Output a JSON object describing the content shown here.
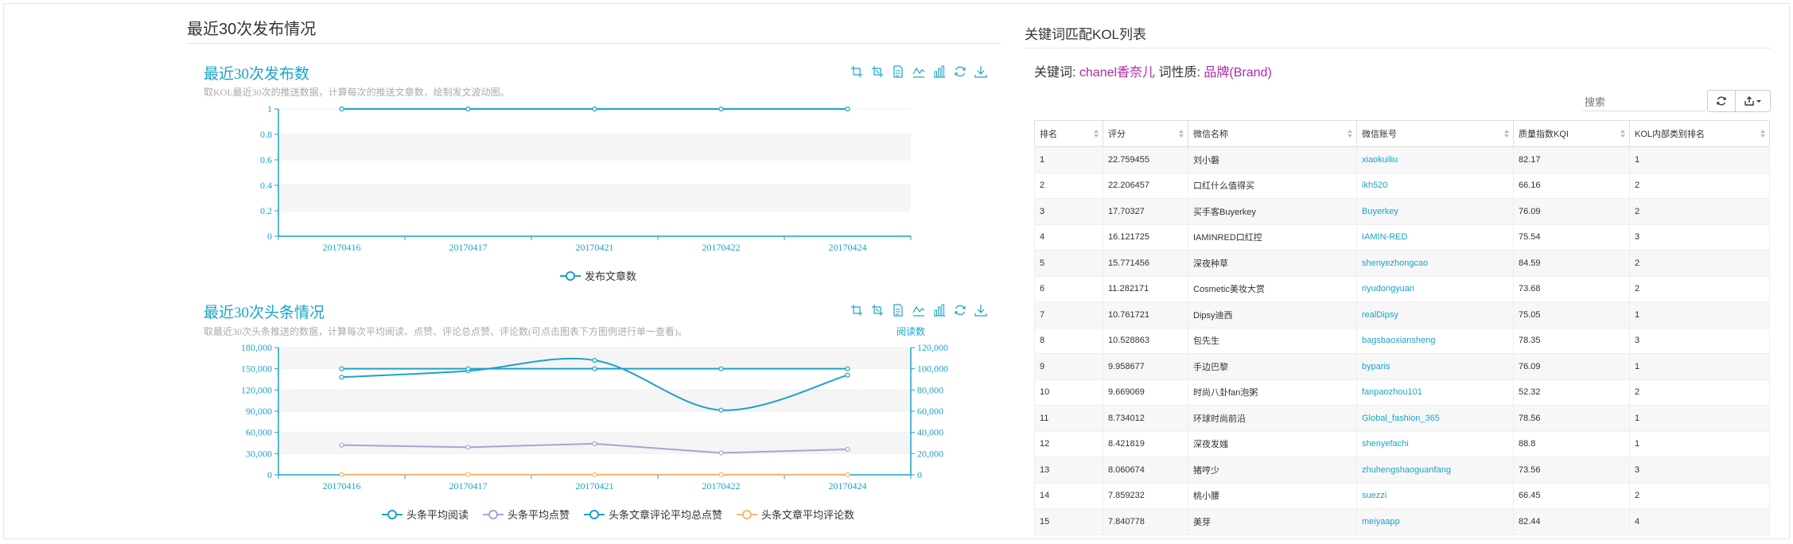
{
  "left": {
    "section_title": "最近30次发布情况",
    "chart1": {
      "title": "最近30次发布数",
      "subtitle": "取KOL最近30次的推送数据，计算每次的推送文章数，绘制发文波动图。"
    },
    "chart2": {
      "title": "最近30次头条情况",
      "subtitle": "取最近30次头条推送的数据，计算每次平均阅读、点赞、评论总点赞、评论数(可点击图表下方图例进行单一查看)。",
      "right_axis_name": "阅读数"
    },
    "toolbox_icons": [
      "zoom-icon",
      "zoom-reset-icon",
      "data-view-icon",
      "line-chart-icon",
      "bar-chart-icon",
      "restore-icon",
      "download-icon"
    ]
  },
  "chart_data": [
    {
      "type": "line",
      "title": "最近30次发布数",
      "categories": [
        "20170416",
        "20170417",
        "20170421",
        "20170422",
        "20170424"
      ],
      "series": [
        {
          "name": "发布文章数",
          "values": [
            1,
            1,
            1,
            1,
            1
          ],
          "color": "#1aa3c9"
        }
      ],
      "ylim": [
        0,
        1
      ],
      "yticks": [
        0,
        0.2,
        0.4,
        0.6,
        0.8,
        1
      ],
      "ytick_labels": [
        "0",
        "0.2",
        "0.4",
        "0.6",
        "0.8",
        "1"
      ],
      "grid": true,
      "legend": "bottom"
    },
    {
      "type": "line",
      "title": "最近30次头条情况",
      "categories": [
        "20170416",
        "20170417",
        "20170421",
        "20170422",
        "20170424"
      ],
      "series": [
        {
          "name": "头条平均阅读",
          "values": [
            92000,
            98000,
            108000,
            61000,
            94000
          ],
          "color": "#1aa3c9",
          "axis": "right"
        },
        {
          "name": "头条平均点赞",
          "values": [
            42000,
            39000,
            44000,
            31000,
            36000
          ],
          "color": "#b39ddb",
          "axis": "left"
        },
        {
          "name": "头条文章评论平均总点赞",
          "values": [
            150000,
            150000,
            150000,
            150000,
            150000
          ],
          "color": "#1aa3c9",
          "axis": "left"
        },
        {
          "name": "头条文章平均评论数",
          "values": [
            300,
            300,
            300,
            300,
            300
          ],
          "color": "#f5b971",
          "axis": "left"
        }
      ],
      "ylim": [
        0,
        180000
      ],
      "yticks": [
        0,
        30000,
        60000,
        90000,
        120000,
        150000,
        180000
      ],
      "ytick_labels": [
        "0",
        "30,000",
        "60,000",
        "90,000",
        "120,000",
        "150,000",
        "180,000"
      ],
      "y2lim": [
        0,
        120000
      ],
      "y2ticks": [
        0,
        20000,
        40000,
        60000,
        80000,
        100000,
        120000
      ],
      "y2tick_labels": [
        "0",
        "20,000",
        "40,000",
        "60,000",
        "80,000",
        "100,000",
        "120,000"
      ],
      "y2label": "阅读数",
      "grid": true,
      "legend": "bottom"
    }
  ],
  "right": {
    "title": "关键词匹配KOL列表",
    "keyword_label": "关键词:",
    "keyword_value": "chanel香奈儿",
    "nature_label": "词性质:",
    "nature_value": "品牌(Brand)",
    "search_placeholder": "搜索",
    "columns": [
      "排名",
      "评分",
      "微信名称",
      "微信账号",
      "质量指数KQI",
      "KOL内部类别排名"
    ],
    "rows": [
      [
        "1",
        "22.759455",
        "刘小磐",
        "xiaokuiliu",
        "82.17",
        "1"
      ],
      [
        "2",
        "22.206457",
        "口红什么值得买",
        "ikh520",
        "66.16",
        "2"
      ],
      [
        "3",
        "17.70327",
        "买手客Buyerkey",
        "Buyerkey",
        "76.09",
        "2"
      ],
      [
        "4",
        "16.121725",
        "IAMINRED口红控",
        "IAMIN-RED",
        "75.54",
        "3"
      ],
      [
        "5",
        "15.771456",
        "深夜种草",
        "shenyezhongcao",
        "84.59",
        "2"
      ],
      [
        "6",
        "11.282171",
        "Cosmetic美妆大赏",
        "riyudongyuan",
        "73.68",
        "2"
      ],
      [
        "7",
        "10.761721",
        "Dipsy迪西",
        "realDipsy",
        "75.05",
        "1"
      ],
      [
        "8",
        "10.528863",
        "包先生",
        "bagsbaoxiansheng",
        "78.35",
        "3"
      ],
      [
        "9",
        "9.958677",
        "手边巴黎",
        "byparis",
        "76.09",
        "1"
      ],
      [
        "10",
        "9.669069",
        "时尚八卦fan泡粥",
        "fanpaozhou101",
        "52.32",
        "2"
      ],
      [
        "11",
        "8.734012",
        "环球时尚前沿",
        "Global_fashion_365",
        "78.56",
        "1"
      ],
      [
        "12",
        "8.421819",
        "深夜发媸",
        "shenyefachi",
        "88.8",
        "1"
      ],
      [
        "13",
        "8.060674",
        "猪哼少",
        "zhuhengshaoguanfang",
        "73.56",
        "3"
      ],
      [
        "14",
        "7.859232",
        "桃小腰",
        "suezzi",
        "66.45",
        "2"
      ],
      [
        "15",
        "7.840778",
        "美芽",
        "meiyaapp",
        "82.44",
        "4"
      ]
    ]
  }
}
